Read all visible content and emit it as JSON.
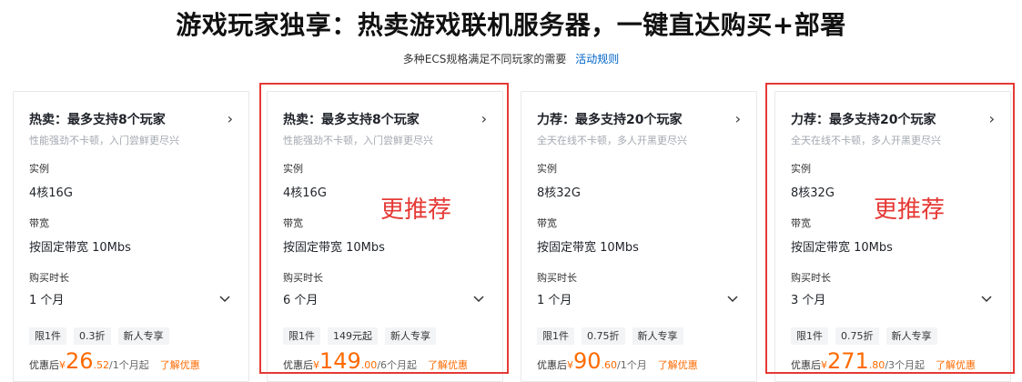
{
  "header": {
    "title": "游戏玩家独享：热卖游戏联机服务器，一键直达购买+部署",
    "subtitle": "多种ECS规格满足不同玩家的需要",
    "rules_link": "活动规则"
  },
  "colors": {
    "accent_orange": "#ff6a00",
    "highlight_red": "#e53935",
    "link_blue": "#0064c8"
  },
  "labels": {
    "instance": "实例",
    "bandwidth": "带宽",
    "duration": "购买时长"
  },
  "annotation": "更推荐",
  "cards": [
    {
      "title": "热卖：最多支持8个玩家",
      "subtitle": "性能强劲不卡顿，入门尝鲜更尽兴",
      "instance": "4核16G",
      "bandwidth": "按固定带宽 10Mbs",
      "duration": "1 个月",
      "tags": [
        "限1件",
        "0.3折",
        "新人专享"
      ],
      "price_prefix": "优惠后",
      "price_yen": "¥",
      "price_int": "26",
      "price_dec": ".52",
      "price_unit": "/1个月起",
      "price_link": "了解优惠"
    },
    {
      "title": "热卖：最多支持8个玩家",
      "subtitle": "性能强劲不卡顿，入门尝鲜更尽兴",
      "instance": "4核16G",
      "bandwidth": "按固定带宽 10Mbs",
      "duration": "6 个月",
      "tags": [
        "限1件",
        "149元起",
        "新人专享"
      ],
      "price_prefix": "优惠后",
      "price_yen": "¥",
      "price_int": "149",
      "price_dec": ".00",
      "price_unit": "/6个月起",
      "price_link": "了解优惠"
    },
    {
      "title": "力荐：最多支持20个玩家",
      "subtitle": "全天在线不卡顿，多人开黑更尽兴",
      "instance": "8核32G",
      "bandwidth": "按固定带宽 10Mbs",
      "duration": "1 个月",
      "tags": [
        "限1件",
        "0.75折",
        "新人专享"
      ],
      "price_prefix": "优惠后",
      "price_yen": "¥",
      "price_int": "90",
      "price_dec": ".60",
      "price_unit": "/1个月",
      "price_link": "了解优惠"
    },
    {
      "title": "力荐：最多支持20个玩家",
      "subtitle": "全天在线不卡顿，多人开黑更尽兴",
      "instance": "8核32G",
      "bandwidth": "按固定带宽 10Mbs",
      "duration": "3 个月",
      "tags": [
        "限1件",
        "0.75折",
        "新人专享"
      ],
      "price_prefix": "优惠后",
      "price_yen": "¥",
      "price_int": "271",
      "price_dec": ".80",
      "price_unit": "/3个月起",
      "price_link": "了解优惠"
    }
  ]
}
